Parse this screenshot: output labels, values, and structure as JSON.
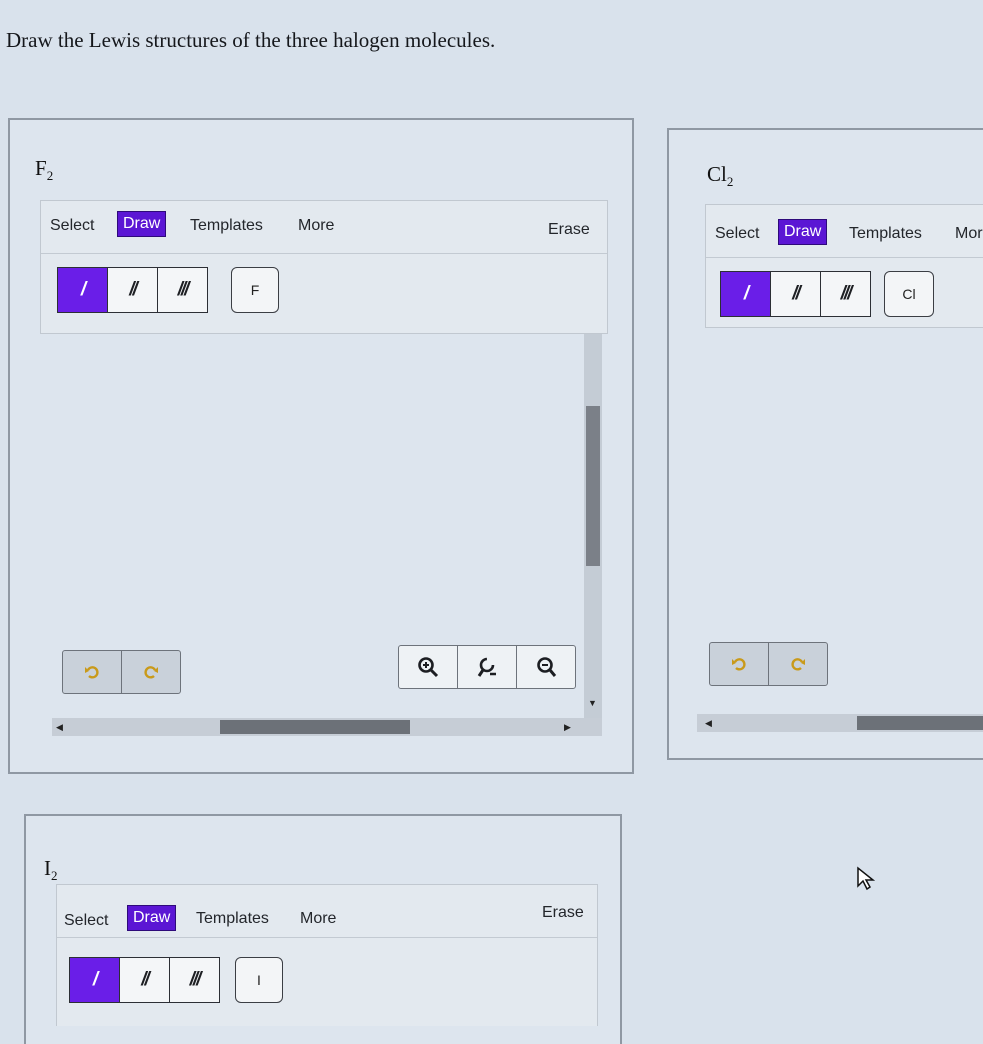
{
  "prompt": "Draw the Lewis structures of the three halogen molecules.",
  "tabs": {
    "select": "Select",
    "draw": "Draw",
    "templates": "Templates",
    "more": "More",
    "more_cut": "Mor",
    "erase": "Erase"
  },
  "bonds": {
    "single": "/",
    "double": "//",
    "triple": "///"
  },
  "panels": {
    "f2": {
      "element": "F",
      "subscript": "2",
      "atom": "F"
    },
    "cl2": {
      "element": "Cl",
      "subscript": "2",
      "atom": "Cl"
    },
    "i2": {
      "element": "I",
      "subscript": "2",
      "atom": "I"
    }
  },
  "colors": {
    "accent": "#5b16d4",
    "bond_active": "#6a1ee8",
    "undo_icon": "#c99a1a"
  },
  "icons": [
    "undo-icon",
    "redo-icon",
    "zoom-in-icon",
    "zoom-reset-icon",
    "zoom-out-icon",
    "pointer-cursor-icon"
  ]
}
